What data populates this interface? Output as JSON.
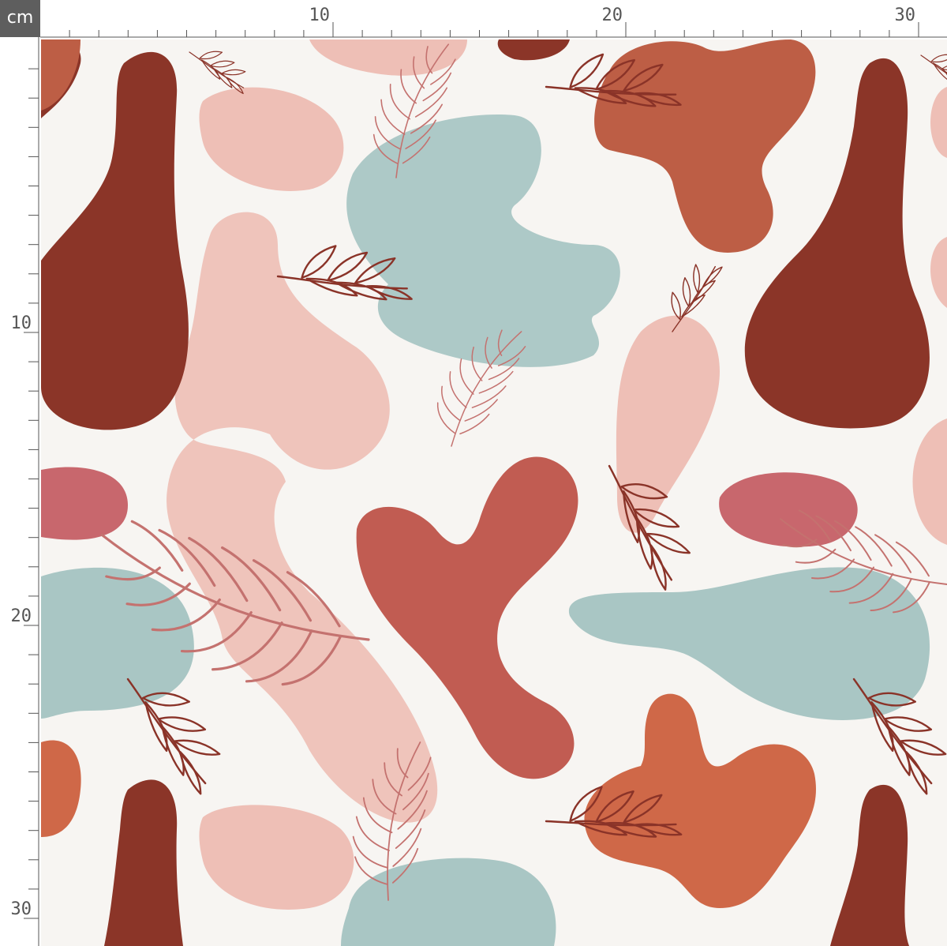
{
  "ruler": {
    "unit": "cm",
    "top_labels": [
      "10",
      "20",
      "30"
    ],
    "left_labels": [
      "10",
      "20",
      "30"
    ]
  },
  "colors": {
    "background": "#f7f5f2",
    "maroon": "#8b3528",
    "terracotta": "#bd5e45",
    "rust_orange": "#cf6848",
    "brick": "#c15c52",
    "rose": "#c8676d",
    "blush": "#eebfb6",
    "sage": "#a9c6c4",
    "leaf_line": "#8a3328",
    "fern_line": "#c4726f",
    "ruler_bg": "#5e5e5e",
    "ruler_text": "#555555"
  },
  "pattern": {
    "name": "abstract blobs with leaf and fern sprigs",
    "icons": [
      "leaf-sprig-icon",
      "fern-frond-icon"
    ]
  }
}
